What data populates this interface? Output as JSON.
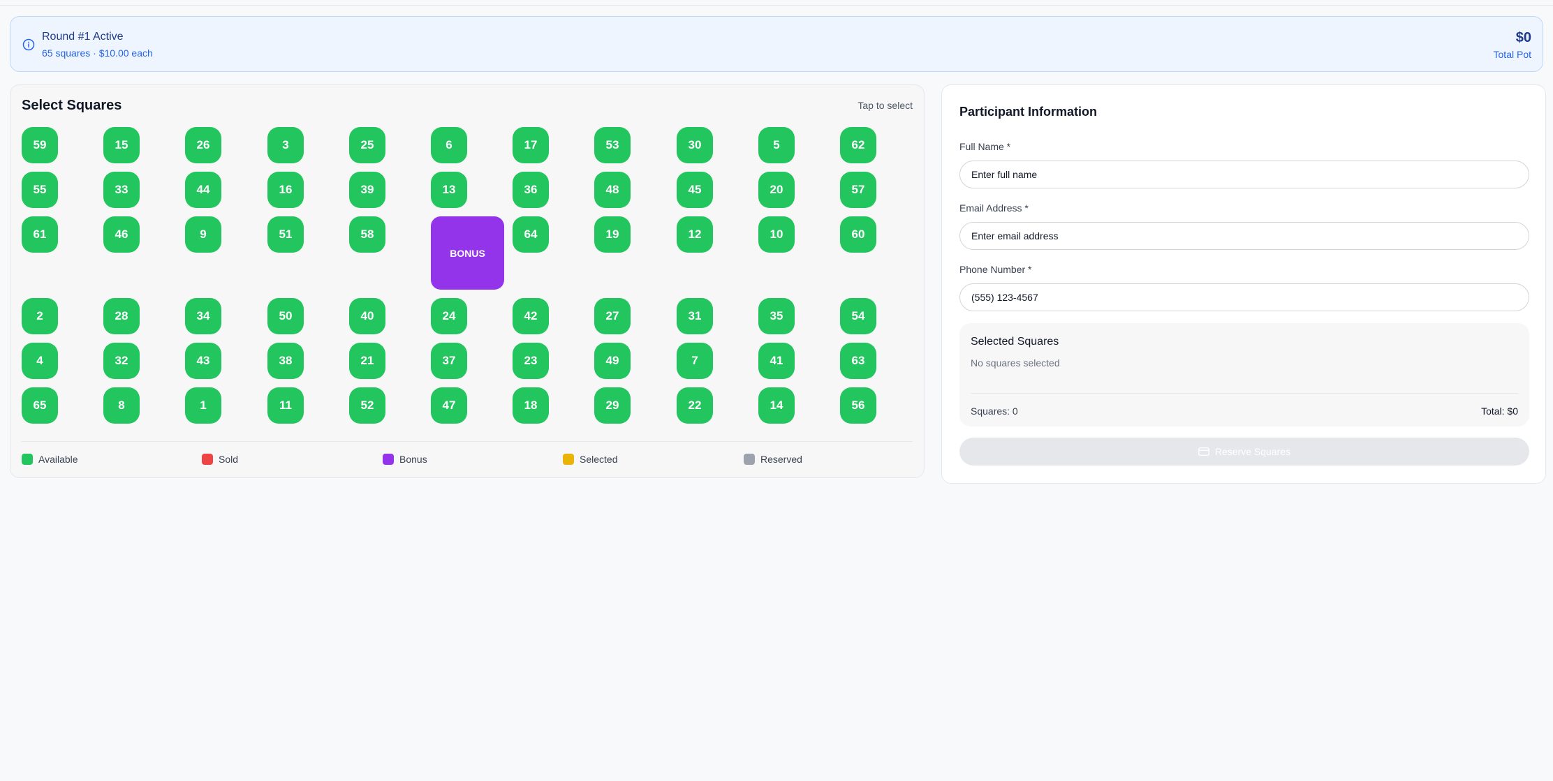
{
  "banner": {
    "title": "Round #1 Active",
    "subtitle": "65 squares · $10.00 each",
    "pot_amount": "$0",
    "pot_label": "Total Pot",
    "icon": "info-icon"
  },
  "squares": {
    "title": "Select Squares",
    "hint": "Tap to select",
    "bonus_label": "BONUS",
    "rows": [
      [
        "59",
        "15",
        "26",
        "3",
        "25",
        "6",
        "17",
        "53",
        "30",
        "5",
        "62"
      ],
      [
        "55",
        "33",
        "44",
        "16",
        "39",
        "13",
        "36",
        "48",
        "45",
        "20",
        "57"
      ],
      [
        "61",
        "46",
        "9",
        "51",
        "58",
        "BONUS",
        "64",
        "19",
        "12",
        "10",
        "60"
      ],
      [
        "2",
        "28",
        "34",
        "50",
        "40",
        "24",
        "42",
        "27",
        "31",
        "35",
        "54"
      ],
      [
        "4",
        "32",
        "43",
        "38",
        "21",
        "37",
        "23",
        "49",
        "7",
        "41",
        "63"
      ],
      [
        "65",
        "8",
        "1",
        "11",
        "52",
        "47",
        "18",
        "29",
        "22",
        "14",
        "56"
      ]
    ],
    "legend": [
      {
        "label": "Available",
        "color": "#22c55e"
      },
      {
        "label": "Sold",
        "color": "#ef4444"
      },
      {
        "label": "Bonus",
        "color": "#9333ea"
      },
      {
        "label": "Selected",
        "color": "#eab308"
      },
      {
        "label": "Reserved",
        "color": "#9ca3af"
      }
    ]
  },
  "participant": {
    "title": "Participant Information",
    "full_name_label": "Full Name *",
    "full_name_placeholder": "Enter full name",
    "email_label": "Email Address *",
    "email_placeholder": "Enter email address",
    "phone_label": "Phone Number *",
    "phone_placeholder": "(555) 123-4567",
    "selected_title": "Selected Squares",
    "selected_empty": "No squares selected",
    "squares_count": "Squares: 0",
    "total": "Total: $0",
    "reserve_label": "Reserve Squares",
    "reserve_icon": "card-icon"
  }
}
